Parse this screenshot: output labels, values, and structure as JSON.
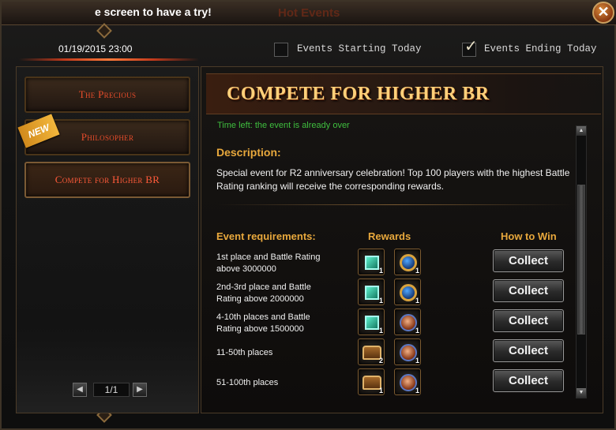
{
  "window": {
    "ticker": "e screen to have a try!",
    "title": "Hot Events",
    "close_label": "✕"
  },
  "datetime": "01/19/2015 23:00",
  "filters": {
    "starting_today": {
      "label": "Events Starting Today",
      "checked": false
    },
    "ending_today": {
      "label": "Events Ending Today",
      "checked": true
    }
  },
  "sidebar": {
    "items": [
      {
        "label": "The Precious"
      },
      {
        "label": "Philosopher",
        "badge": "NEW"
      },
      {
        "label": "Compete for Higher BR",
        "active": true
      }
    ],
    "pager": {
      "prev": "◀",
      "value": "1/1",
      "next": "▶"
    }
  },
  "event": {
    "title": "COMPETE FOR HIGHER BR",
    "time_left": "Time left: the event is already over",
    "description_heading": "Description:",
    "description": "Special event for R2 anniversary celebration! Top 100 players with the highest Battle Rating ranking will receive the corresponding rewards.",
    "columns": {
      "requirements": "Event requirements:",
      "rewards": "Rewards",
      "how_to_win": "How to Win"
    },
    "rows": [
      {
        "requirement": "1st place and Battle Rating above 3000000",
        "rewards": [
          {
            "icon": "gem-icon",
            "qty": "1"
          },
          {
            "icon": "medal-icon",
            "qty": "1"
          }
        ],
        "action": "Collect"
      },
      {
        "requirement": "2nd-3rd place and Battle Rating above 2000000",
        "rewards": [
          {
            "icon": "gem-icon",
            "qty": "1"
          },
          {
            "icon": "medal-icon",
            "qty": "1"
          }
        ],
        "action": "Collect"
      },
      {
        "requirement": "4-10th places and Battle Rating above 1500000",
        "rewards": [
          {
            "icon": "gem-icon",
            "qty": "1"
          },
          {
            "icon": "orb-icon",
            "qty": "1"
          }
        ],
        "action": "Collect"
      },
      {
        "requirement": "11-50th places",
        "rewards": [
          {
            "icon": "chest-icon",
            "qty": "2"
          },
          {
            "icon": "orb-icon",
            "qty": "1"
          }
        ],
        "action": "Collect"
      },
      {
        "requirement": "51-100th places",
        "rewards": [
          {
            "icon": "chest-icon",
            "qty": "1"
          },
          {
            "icon": "orb-icon",
            "qty": "1"
          }
        ],
        "action": "Collect"
      }
    ]
  },
  "scrollbar": {
    "up": "▲",
    "down": "▼"
  }
}
